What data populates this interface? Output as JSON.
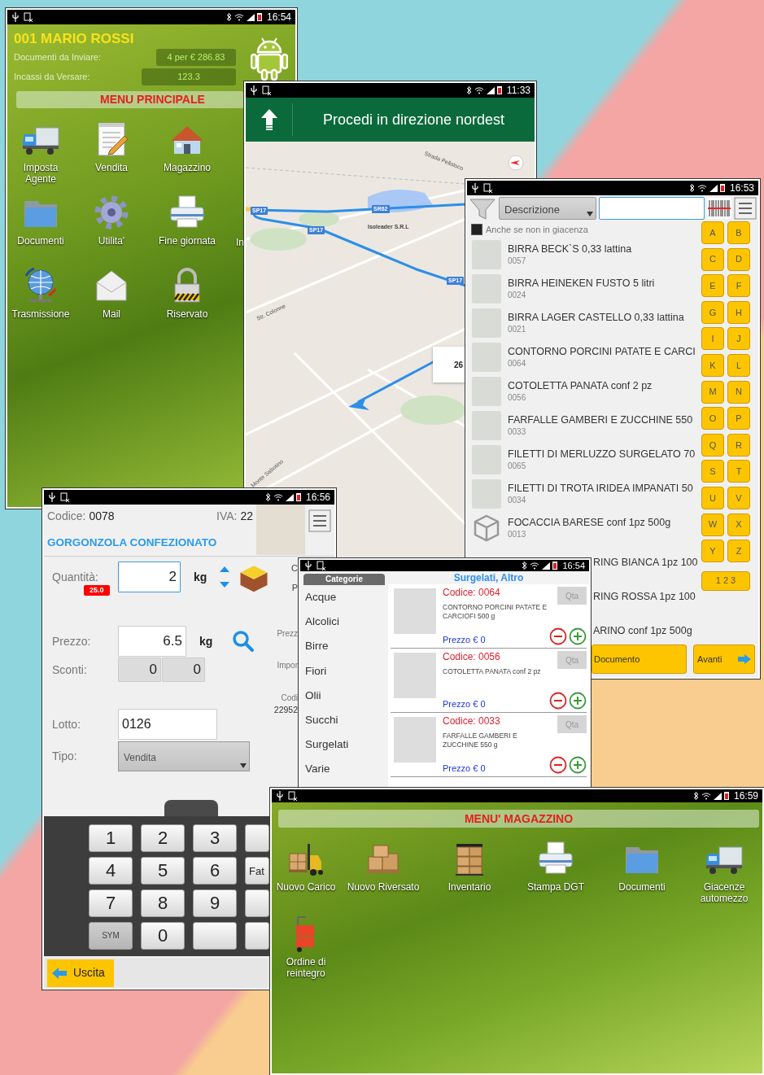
{
  "main_menu": {
    "status_time": "16:54",
    "agent": "001 MARIO ROSSI",
    "summary": [
      {
        "label": "Documenti da Inviare:",
        "value": "4 per € 286.83"
      },
      {
        "label": "Incassi da Versare:",
        "value": "123.3"
      }
    ],
    "menu_title": "MENU PRINCIPALE",
    "rows": [
      [
        "Imposta Agente",
        "Vendita",
        "Magazzino"
      ],
      [
        "Documenti",
        "Utilita'",
        "Fine giornata",
        "In"
      ],
      [
        "Trasmissione",
        "Mail",
        "Riservato"
      ]
    ]
  },
  "navigation": {
    "status_time": "11:33",
    "instruction": "Procedi in direzione nordest",
    "map_labels": [
      {
        "text": "SP17",
        "kind": "shield"
      },
      {
        "text": "SR62",
        "kind": "shield"
      },
      {
        "text": "Isoleader S.R.L",
        "kind": "place"
      },
      {
        "text": "SP17",
        "kind": "shield"
      },
      {
        "text": "SP17",
        "kind": "shield"
      },
      {
        "text": "Str. Colonne",
        "kind": "road"
      },
      {
        "text": "Strada Pellaloco",
        "kind": "road"
      },
      {
        "text": "Monte Sabotino",
        "kind": "road"
      }
    ],
    "distance_callout": "26"
  },
  "product_search": {
    "status_time": "16:53",
    "filter_field": "Descrizione",
    "stock_option": {
      "label": "Anche se non in giacenza",
      "checked": false
    },
    "products": [
      {
        "name": "BIRRA BECK`S 0,33 lattina",
        "code": "0057",
        "kind": "full"
      },
      {
        "name": "BIRRA HEINEKEN FUSTO 5 litri",
        "code": "0024",
        "kind": "full"
      },
      {
        "name": "BIRRA LAGER CASTELLO 0,33 lattina",
        "code": "0021",
        "kind": "full"
      },
      {
        "name": "CONTORNO PORCINI PATATE E CARCI",
        "code": "0064",
        "kind": "full"
      },
      {
        "name": "COTOLETTA PANATA conf 2 pz",
        "code": "0056",
        "kind": "full"
      },
      {
        "name": "FARFALLE GAMBERI E ZUCCHINE 550",
        "code": "0033",
        "kind": "full"
      },
      {
        "name": "FILETTI DI MERLUZZO SURGELATO 70",
        "code": "0065",
        "kind": "full"
      },
      {
        "name": "FILETTI DI TROTA IRIDEA IMPANATI 50",
        "code": "0034",
        "kind": "full"
      },
      {
        "name": "FOCACCIA BARESE conf 1pz 500g",
        "code": "0013",
        "kind": "full"
      },
      {
        "name": "RING BIANCA 1pz 100",
        "kind": "partial"
      },
      {
        "name": "RING ROSSA 1pz 100",
        "kind": "partial"
      },
      {
        "name": "ARINO conf 1pz 500g",
        "kind": "partial"
      }
    ],
    "letters": [
      "A",
      "B",
      "C",
      "D",
      "E",
      "F",
      "G",
      "H",
      "I",
      "J",
      "K",
      "L",
      "M",
      "N",
      "O",
      "P",
      "Q",
      "R",
      "S",
      "T",
      "U",
      "V",
      "W",
      "X",
      "Y",
      "Z"
    ],
    "numbers_button": "1 2 3",
    "document_button": "Documento",
    "next_button": "Avanti"
  },
  "item_entry": {
    "status_time": "16:56",
    "code_label": "Codice:",
    "code": "0078",
    "vat_label": "IVA:",
    "vat": "22",
    "product_name": "GORGONZOLA CONFEZIONATO",
    "quantity": {
      "label": "Quantità:",
      "value": "2",
      "unit": "kg",
      "stock_badge": "25.0"
    },
    "price": {
      "label": "Prezzo:",
      "value": "6.5",
      "unit": "kg"
    },
    "discounts": {
      "label": "Sconti:",
      "values": [
        "0",
        "0"
      ]
    },
    "lot": {
      "label": "Lotto:",
      "value": "0126"
    },
    "type": {
      "label": "Tipo:",
      "value": "Vendita"
    },
    "side_labels": [
      "C",
      "P",
      "Prezz",
      "Impor",
      "Codi",
      "22952"
    ],
    "keypad": [
      [
        "1",
        "2",
        "3"
      ],
      [
        "4",
        "5",
        "6",
        "Fat"
      ],
      [
        "7",
        "8",
        "9"
      ],
      [
        "SYM",
        "0"
      ]
    ],
    "exit_button": "Uscita"
  },
  "catalog": {
    "status_time": "16:54",
    "categories_title": "Categorie",
    "categories": [
      "Acque",
      "Alcolici",
      "Birre",
      "Fiori",
      "Olii",
      "Succhi",
      "Surgelati",
      "Varie"
    ],
    "group_title": "Surgelati, Altro",
    "products": [
      {
        "code": "Codice: 0064",
        "name": "CONTORNO PORCINI PATATE E CARCIOFI 500 g",
        "price": "Prezzo € 0",
        "qty_placeholder": "Qta"
      },
      {
        "code": "Codice: 0056",
        "name": "COTOLETTA PANATA conf 2 pz",
        "price": "Prezzo € 0",
        "qty_placeholder": "Qta"
      },
      {
        "code": "Codice: 0033",
        "name": "FARFALLE GAMBERI E ZUCCHINE 550 g",
        "price": "Prezzo € 0",
        "qty_placeholder": "Qta"
      }
    ]
  },
  "warehouse_menu": {
    "status_time": "16:59",
    "menu_title": "MENU' MAGAZZINO",
    "rows": [
      [
        "Nuovo Carico",
        "Nuovo Riversato",
        "Inventario",
        "Stampa DGT",
        "Documenti",
        "Giacenze automezzo"
      ],
      [
        "Ordine di reintegro"
      ]
    ]
  }
}
